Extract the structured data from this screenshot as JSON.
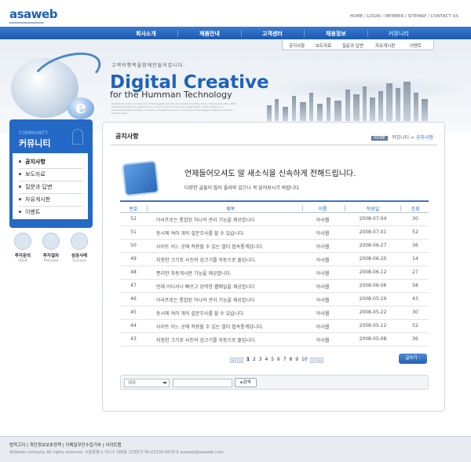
{
  "header": {
    "logo": "asaweb",
    "top_links": "HOME / LOGIN / MEMBER / SITEMAP / CONTACT US"
  },
  "nav": {
    "items": [
      {
        "label": "회사소개",
        "active": false
      },
      {
        "label": "제품안내",
        "active": false
      },
      {
        "label": "고객센터",
        "active": false
      },
      {
        "label": "채용정보",
        "active": false
      },
      {
        "label": "커뮤니티",
        "active": true
      }
    ],
    "sub_items": [
      "공지사항",
      "보도자료",
      "질문과 답변",
      "자유게시판",
      "이벤트"
    ]
  },
  "hero": {
    "tagline": "고객의행복을함께만들어갑니다.",
    "title_main": "Digital Creative",
    "title_sub": "for the Humman Technology",
    "body_text": "Asaweb has been running one of the biggest network and creative building sites in Korea since May 2005. Most that utilized our network since, this includes 'all quarters' organization, while making' our international partnerships. In addition, Asaweb has been running one of the biggest network and three building sites."
  },
  "sidebar": {
    "heading_en": "COMMUNITY",
    "heading_ko": "커뮤니티",
    "items": [
      {
        "label": "공지사항",
        "active": true
      },
      {
        "label": "보도자료",
        "active": false
      },
      {
        "label": "질문과 답변",
        "active": false
      },
      {
        "label": "자유게시판",
        "active": false
      },
      {
        "label": "이벤트",
        "active": false
      }
    ],
    "quick_links": [
      {
        "title": "투자문의",
        "subtitle": "Q&A",
        "icon": "magnifier-icon"
      },
      {
        "title": "투자절차",
        "subtitle": "Process",
        "icon": "monitor-icon"
      },
      {
        "title": "성공사례",
        "subtitle": "Sucess",
        "icon": "globe-icon"
      }
    ]
  },
  "content": {
    "title": "공지사항",
    "breadcrumb": {
      "home": "HOME",
      "level1": "커뮤니티",
      "current": "공지사항"
    },
    "notice_heading": "언제들어오셔도 알 새소식을 신속하게 전해드립니다.",
    "notice_sub": "다양한 글들이 많이 올라와 있으니 꼭 읽어보시기 바랍니다.",
    "table": {
      "headers": {
        "no": "번호",
        "title": "제목",
        "author": "이름",
        "date": "작성일",
        "views": "조회"
      },
      "rows": [
        {
          "no": "52",
          "title": "아사프로는 통합된 하나의 관리 기능을 제공합니다",
          "author": "아사웹",
          "date": "2008-07-04",
          "views": "30"
        },
        {
          "no": "51",
          "title": "동시에 여러 개의 설문조사를 할 수 있습니다.",
          "author": "아사웹",
          "date": "2008-07-01",
          "views": "52"
        },
        {
          "no": "50",
          "title": "사이트 어느 곳에 적용할 수 있는 멀티 접속통계입니다.",
          "author": "아사웹",
          "date": "2008-06-27",
          "views": "36"
        },
        {
          "no": "49",
          "title": "지정한 크기로 사진의 섬크기를 자동으로 줄입니다.",
          "author": "아사웹",
          "date": "2008-06-20",
          "views": "14"
        },
        {
          "no": "48",
          "title": "편리한 자동게시판 기능을 제공합니다.",
          "author": "아사웹",
          "date": "2008-06-12",
          "views": "27"
        },
        {
          "no": "47",
          "title": "언제 어디서나 빠르고 강력한 웹메일을 제공합니다",
          "author": "아사웹",
          "date": "2008-06-06",
          "views": "58"
        },
        {
          "no": "46",
          "title": "아사프로는 통합된 하나의 관리 기능을 제공합니다",
          "author": "아사웹",
          "date": "2008-05-29",
          "views": "43"
        },
        {
          "no": "45",
          "title": "동시에 여러 개의 설문조사를 할 수 있습니다.",
          "author": "아사웹",
          "date": "2008-05-22",
          "views": "30"
        },
        {
          "no": "44",
          "title": "사이트 어느 곳에 적용할 수 있는 멀티 접속통계입니다.",
          "author": "아사웹",
          "date": "2008-05-12",
          "views": "52"
        },
        {
          "no": "43",
          "title": "지정한 크기로 사진의 섬크기를 자동으로 줄입니다.",
          "author": "아사웹",
          "date": "2008-05-08",
          "views": "36"
        }
      ]
    },
    "pagination": {
      "pages": [
        "1",
        "2",
        "3",
        "4",
        "5",
        "6",
        "7",
        "8",
        "9",
        "10"
      ],
      "current": "1"
    },
    "write_button": "글쓰기",
    "search": {
      "select_value": "제목",
      "button": "검색",
      "input_value": ""
    }
  },
  "footer": {
    "links": "법적고지 | 개인정보보호정책 | 이메일무단수집거부 | 사이트맵",
    "copyright": "ASAweb company. All rights reserved. 서울특별시 가나구 대래동 123번지 Tel.01234-5678-9 asaweb@asaweb.com"
  },
  "colors": {
    "accent": "#2469c6",
    "nav": "#1c58b0",
    "panel_border": "#cfd7e2"
  }
}
